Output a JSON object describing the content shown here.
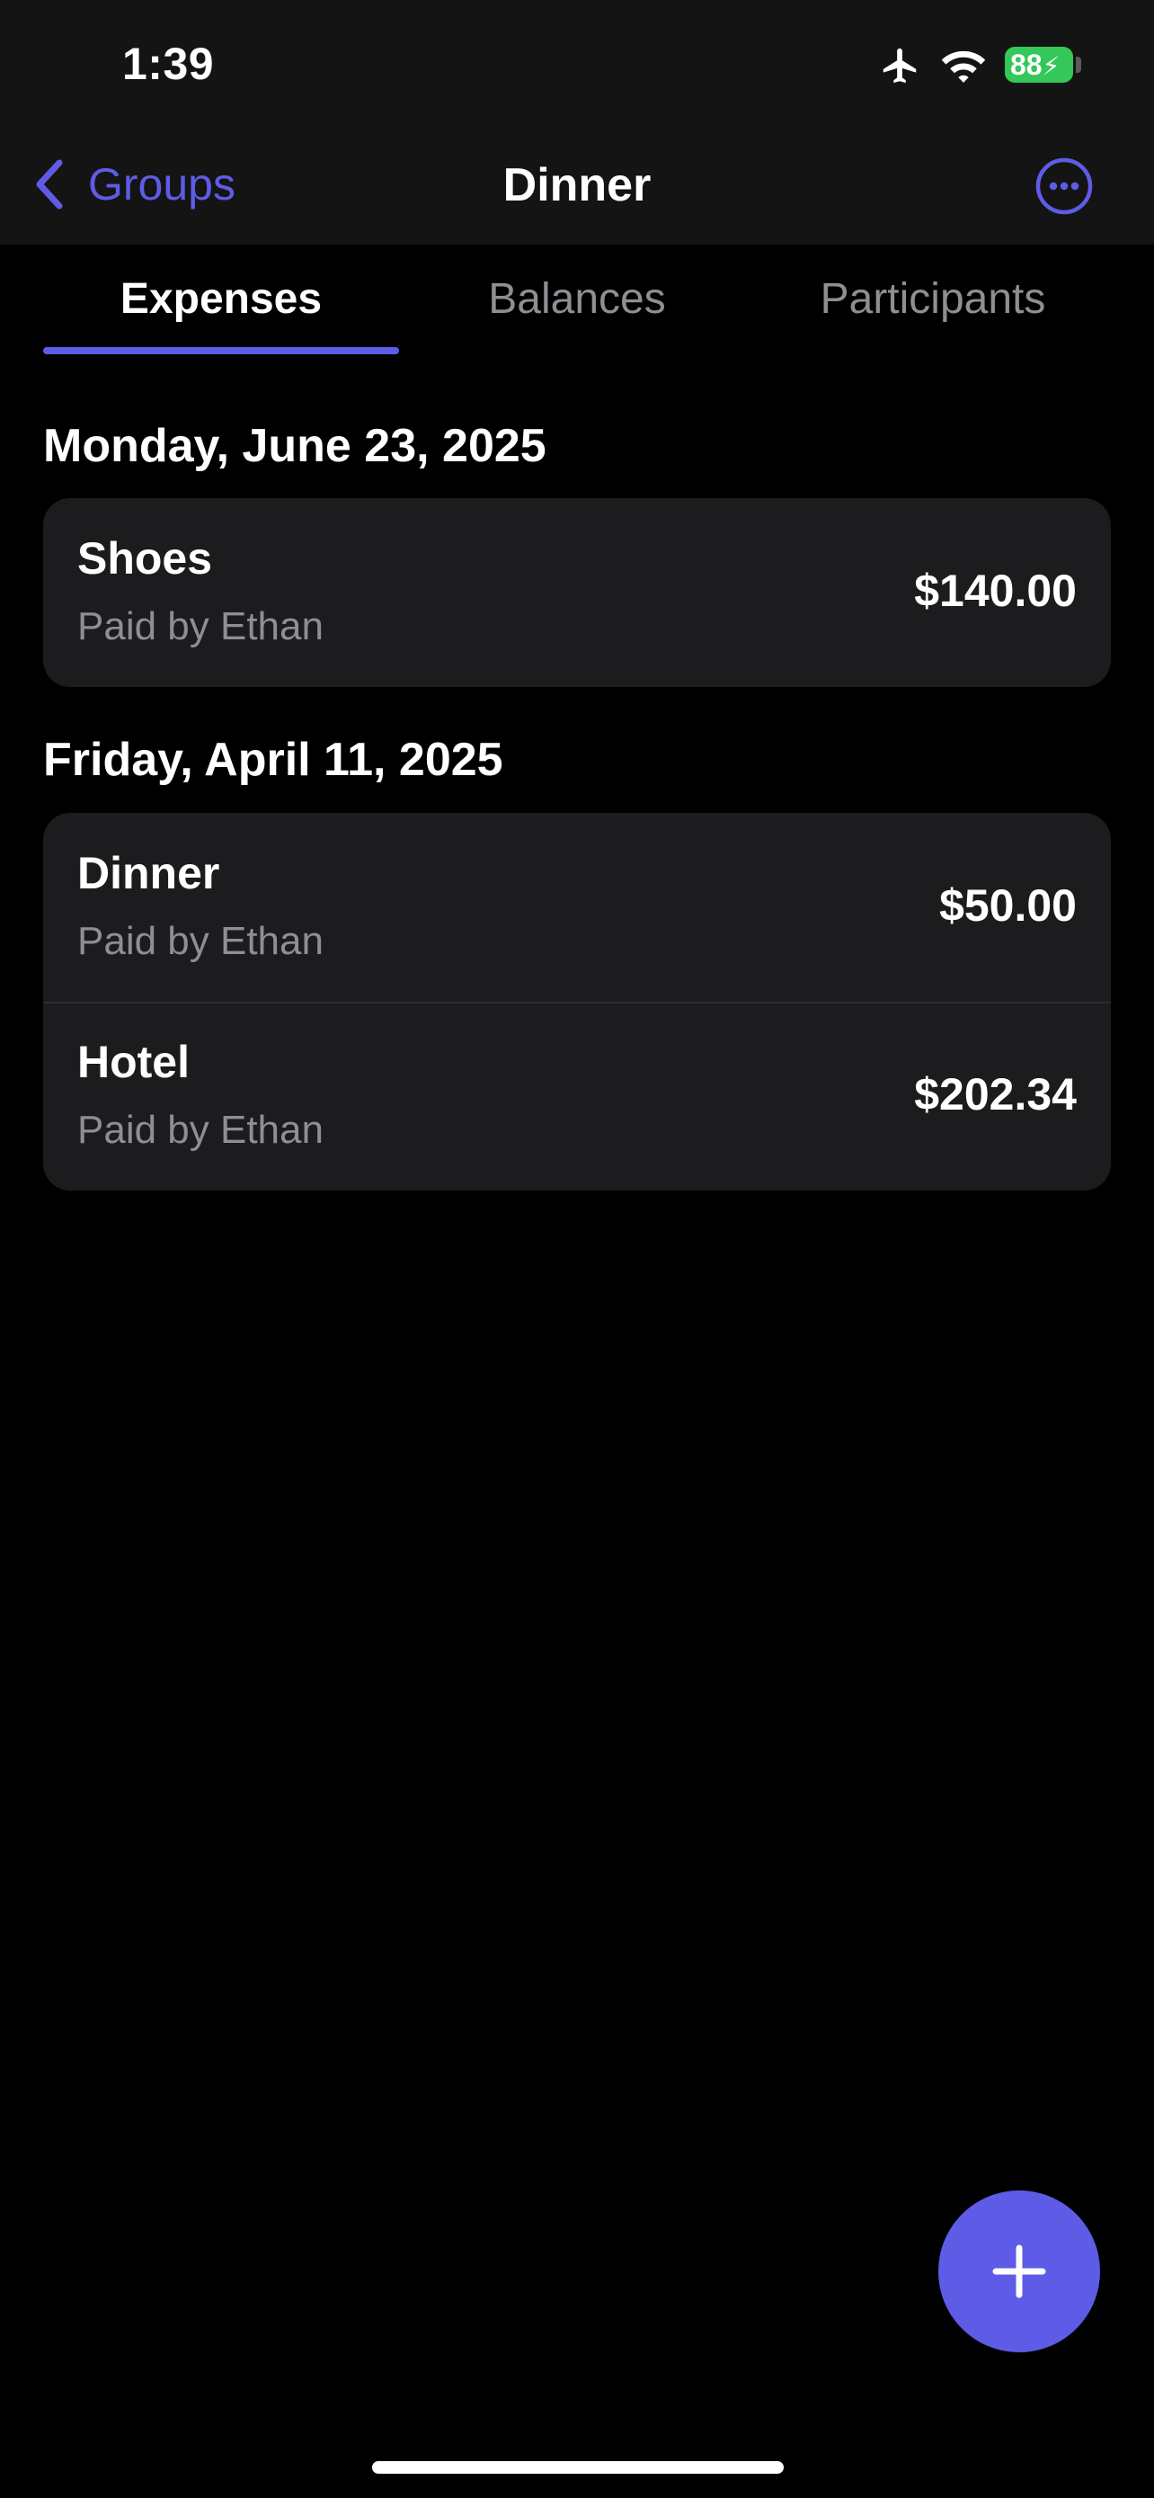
{
  "status_bar": {
    "time": "1:39",
    "battery": "88"
  },
  "nav": {
    "back_label": "Groups",
    "title": "Dinner"
  },
  "tabs": [
    {
      "label": "Expenses",
      "active": true
    },
    {
      "label": "Balances",
      "active": false
    },
    {
      "label": "Participants",
      "active": false
    }
  ],
  "sections": [
    {
      "date": "Monday, June 23, 2025",
      "expenses": [
        {
          "title": "Shoes",
          "paid_by": "Paid by Ethan",
          "amount": "$140.00"
        }
      ]
    },
    {
      "date": "Friday, April 11, 2025",
      "expenses": [
        {
          "title": "Dinner",
          "paid_by": "Paid by Ethan",
          "amount": "$50.00"
        },
        {
          "title": "Hotel",
          "paid_by": "Paid by Ethan",
          "amount": "$202.34"
        }
      ]
    }
  ],
  "colors": {
    "accent": "#5e5ce6",
    "background": "#000000",
    "card": "#1c1c1e",
    "secondary_text": "#8e8e93",
    "battery_green": "#34c759"
  },
  "icons": {
    "back": "chevron-left-icon",
    "more": "ellipsis-circle-icon",
    "add": "plus-icon",
    "airplane": "airplane-icon",
    "wifi": "wifi-icon"
  }
}
